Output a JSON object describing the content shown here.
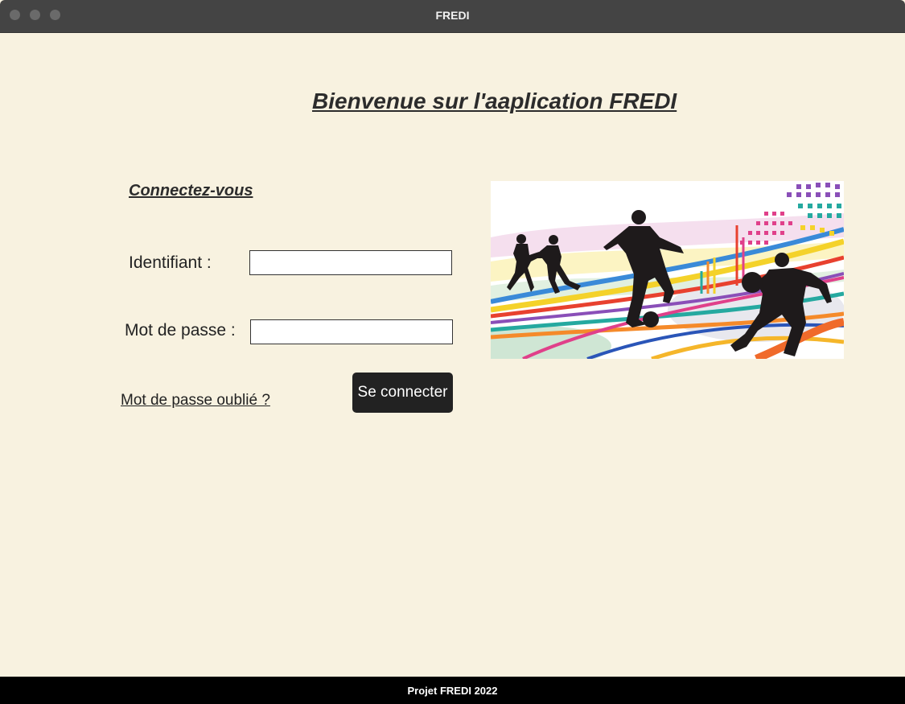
{
  "window": {
    "title": "FREDI"
  },
  "header": {
    "welcome": "Bienvenue sur l'aaplication FREDI"
  },
  "login": {
    "title": "Connectez-vous",
    "username_label": "Identifiant :",
    "username_value": "",
    "password_label": "Mot de passe :",
    "password_value": "",
    "forgot_link": "Mot de passe oublié ?",
    "submit_label": "Se connecter"
  },
  "banner": {
    "icon": "sports-silhouettes-image"
  },
  "footer": {
    "text": "Projet FREDI 2022"
  },
  "colors": {
    "background": "#f8f2e0",
    "titlebar": "#444444",
    "button": "#222222",
    "footer": "#000000"
  }
}
